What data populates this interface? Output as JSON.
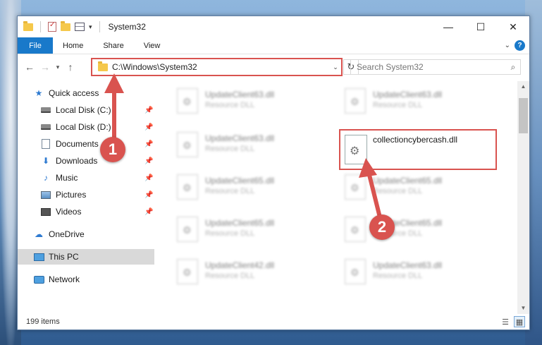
{
  "window": {
    "title": "System32",
    "controls": {
      "minimize": "—",
      "maximize": "☐",
      "close": "✕"
    }
  },
  "ribbon": {
    "tabs": [
      "File",
      "Home",
      "Share",
      "View"
    ],
    "help": "?"
  },
  "nav": {
    "address": "C:\\Windows\\System32",
    "search_placeholder": "Search System32"
  },
  "sidebar": {
    "items": [
      {
        "label": "Quick access"
      },
      {
        "label": "Local Disk (C:)"
      },
      {
        "label": "Local Disk (D:)"
      },
      {
        "label": "Documents"
      },
      {
        "label": "Downloads"
      },
      {
        "label": "Music"
      },
      {
        "label": "Pictures"
      },
      {
        "label": "Videos"
      },
      {
        "label": "OneDrive"
      },
      {
        "label": "This PC"
      },
      {
        "label": "Network"
      }
    ]
  },
  "files": {
    "blurred": [
      {
        "name": "UpdateClient63.dll",
        "desc": "Resource DLL"
      },
      {
        "name": "UpdateClient63.dll",
        "desc": "Resource DLL"
      },
      {
        "name": "UpdateClient63.dll",
        "desc": "Resource DLL"
      },
      {
        "name": "UpdateClient65.dll",
        "desc": "Resource DLL"
      },
      {
        "name": "UpdateClient65.dll",
        "desc": "Resource DLL"
      },
      {
        "name": "UpdateClient65.dll",
        "desc": "Resource DLL"
      },
      {
        "name": "UpdateClient65.dll",
        "desc": "Resource DLL"
      },
      {
        "name": "UpdateClient42.dll",
        "desc": "Resource DLL"
      },
      {
        "name": "UpdateClient63.dll",
        "desc": "Resource DLL"
      }
    ],
    "highlighted": {
      "name": "collectioncybercash.dll"
    }
  },
  "status": {
    "count": "199 items"
  },
  "annotations": {
    "step1": "1",
    "step2": "2",
    "color": "#d9534f"
  }
}
